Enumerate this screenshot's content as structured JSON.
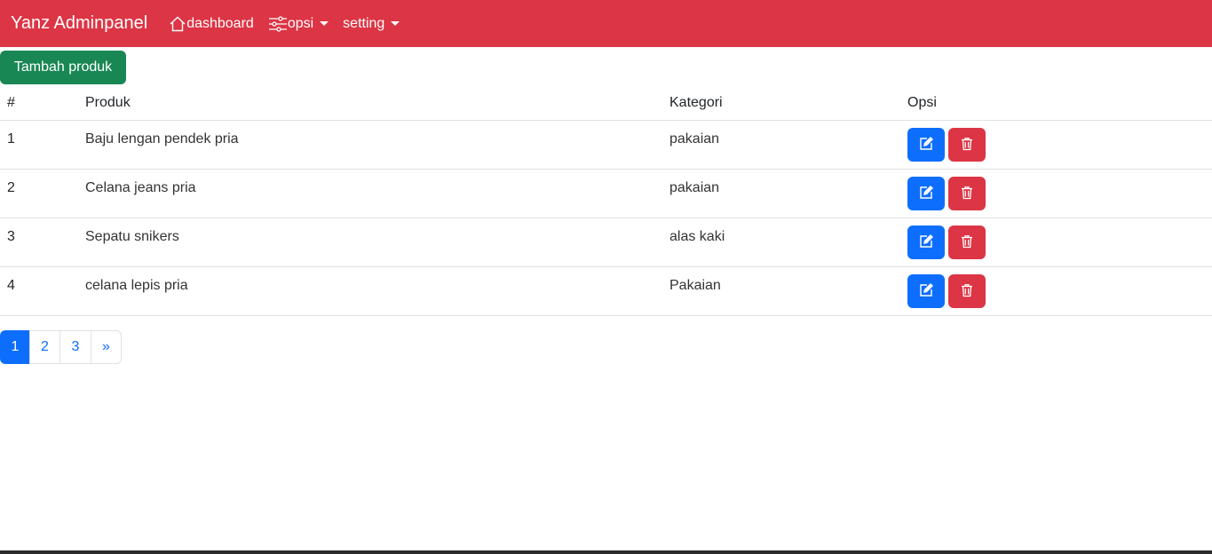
{
  "navbar": {
    "brand": "Yanz Adminpanel",
    "links": [
      {
        "label": "dashboard",
        "icon": "house-icon"
      },
      {
        "label": "opsi",
        "icon": "sliders-icon",
        "dropdown": true
      },
      {
        "label": "setting",
        "dropdown": true
      }
    ],
    "color": "#dc3545"
  },
  "add_button": {
    "label": "Tambah produk",
    "color": "#198754"
  },
  "table": {
    "headers": [
      "#",
      "Produk",
      "Kategori",
      "Opsi"
    ],
    "rows": [
      {
        "num": "1",
        "produk": "Baju lengan pendek pria",
        "kategori": "pakaian"
      },
      {
        "num": "2",
        "produk": "Celana jeans pria",
        "kategori": "pakaian"
      },
      {
        "num": "3",
        "produk": "Sepatu snikers",
        "kategori": "alas kaki"
      },
      {
        "num": "4",
        "produk": "celana lepis pria",
        "kategori": "Pakaian"
      }
    ],
    "edit_icon": "edit-icon",
    "delete_icon": "trash-icon",
    "edit_color": "#0d6efd",
    "delete_color": "#dc3545"
  },
  "pagination": {
    "pages": [
      "1",
      "2",
      "3"
    ],
    "next": "»",
    "active": "1"
  }
}
